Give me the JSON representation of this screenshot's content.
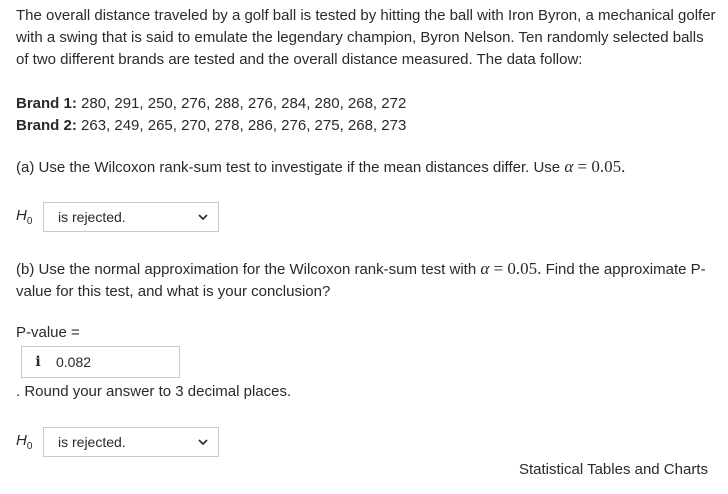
{
  "question": {
    "intro": "The overall distance traveled by a golf ball is tested by hitting the ball with Iron Byron, a mechanical golfer with a swing that is said to emulate the legendary champion, Byron Nelson. Ten randomly selected balls of two different brands are tested and the overall distance measured. The data follow:",
    "brand1_label": "Brand 1:",
    "brand1_values": "280, 291, 250, 276, 288, 276, 284, 280, 268, 272",
    "brand2_label": "Brand 2:",
    "brand2_values": "263, 249, 265, 270, 278, 286, 276, 275, 268, 273"
  },
  "part_a": {
    "text": "(a) Use the Wilcoxon rank-sum test to investigate if the mean distances differ. Use",
    "alpha_expr": "= 0.05.",
    "h0_select": "is rejected."
  },
  "part_b": {
    "text": "(b) Use the normal approximation for the Wilcoxon rank-sum test with",
    "alpha_expr": "= 0.05.",
    "text2": "Find the approximate P-value for this test, and what is your conclusion?",
    "pvalue_label": "P-value =",
    "pvalue_value": "0.082",
    "round_text": ". Round your answer to 3 decimal places.",
    "h0_select": "is rejected."
  },
  "footer": {
    "link": "Statistical Tables and Charts"
  },
  "icons": {
    "info": "info-icon",
    "chevron": "chevron-down-icon"
  }
}
